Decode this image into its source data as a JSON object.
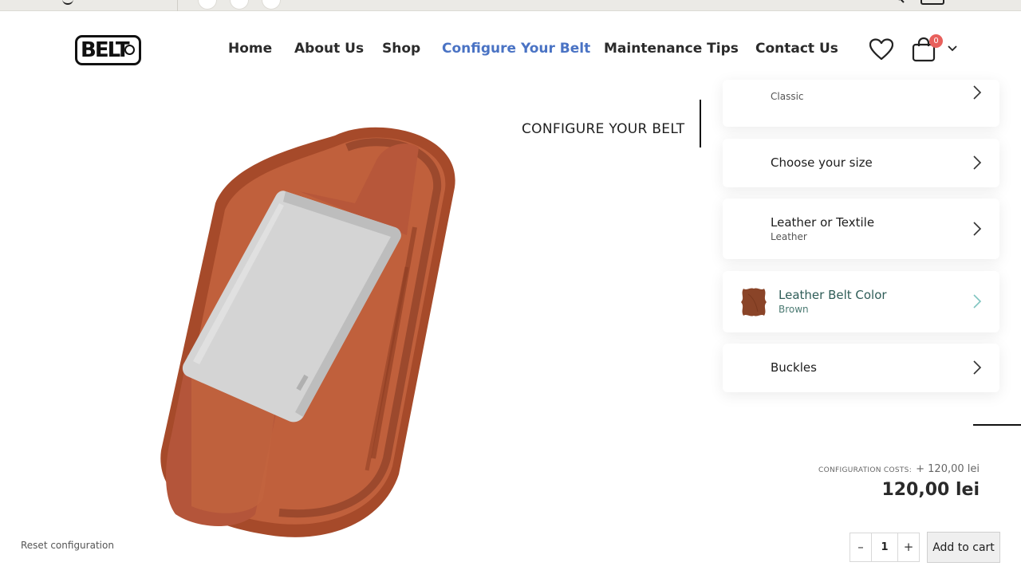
{
  "header": {
    "logo_text": "BELT",
    "nav": [
      {
        "label": "Home"
      },
      {
        "label": "About Us"
      },
      {
        "label": "Shop"
      },
      {
        "label": "Configure Your Belt",
        "active": true
      },
      {
        "label": "Maintenance Tips"
      },
      {
        "label": "Contact Us"
      }
    ],
    "cart_count": "0",
    "icons": [
      "heart-icon",
      "shopping-bag-icon",
      "chevron-down-icon",
      "search-icon",
      "user-icon"
    ]
  },
  "configurator": {
    "title": "CONFIGURE YOUR BELT",
    "steps": [
      {
        "title": "",
        "subtitle": "Classic"
      },
      {
        "title": "Choose your size",
        "subtitle": ""
      },
      {
        "title": "Leather or Textile",
        "subtitle": "Leather"
      },
      {
        "title": "Leather Belt Color",
        "subtitle": "Brown",
        "selected": true,
        "swatch_color": "#8a4428"
      },
      {
        "title": "Buckles",
        "subtitle": ""
      }
    ]
  },
  "pricing": {
    "config_label": "Configuration costs:",
    "config_value": "+ 120,00 lei",
    "total": "120,00 lei"
  },
  "actions": {
    "reset_label": "Reset configuration",
    "quantity": "1",
    "minus": "–",
    "plus": "+",
    "add_to_cart": "Add to cart"
  },
  "colors": {
    "accent_nav": "#4a73c4",
    "selected_step": "#2f5d58",
    "badge": "#e8605c",
    "belt_leather": "#b0512f",
    "buckle": "#cfcfcf"
  }
}
